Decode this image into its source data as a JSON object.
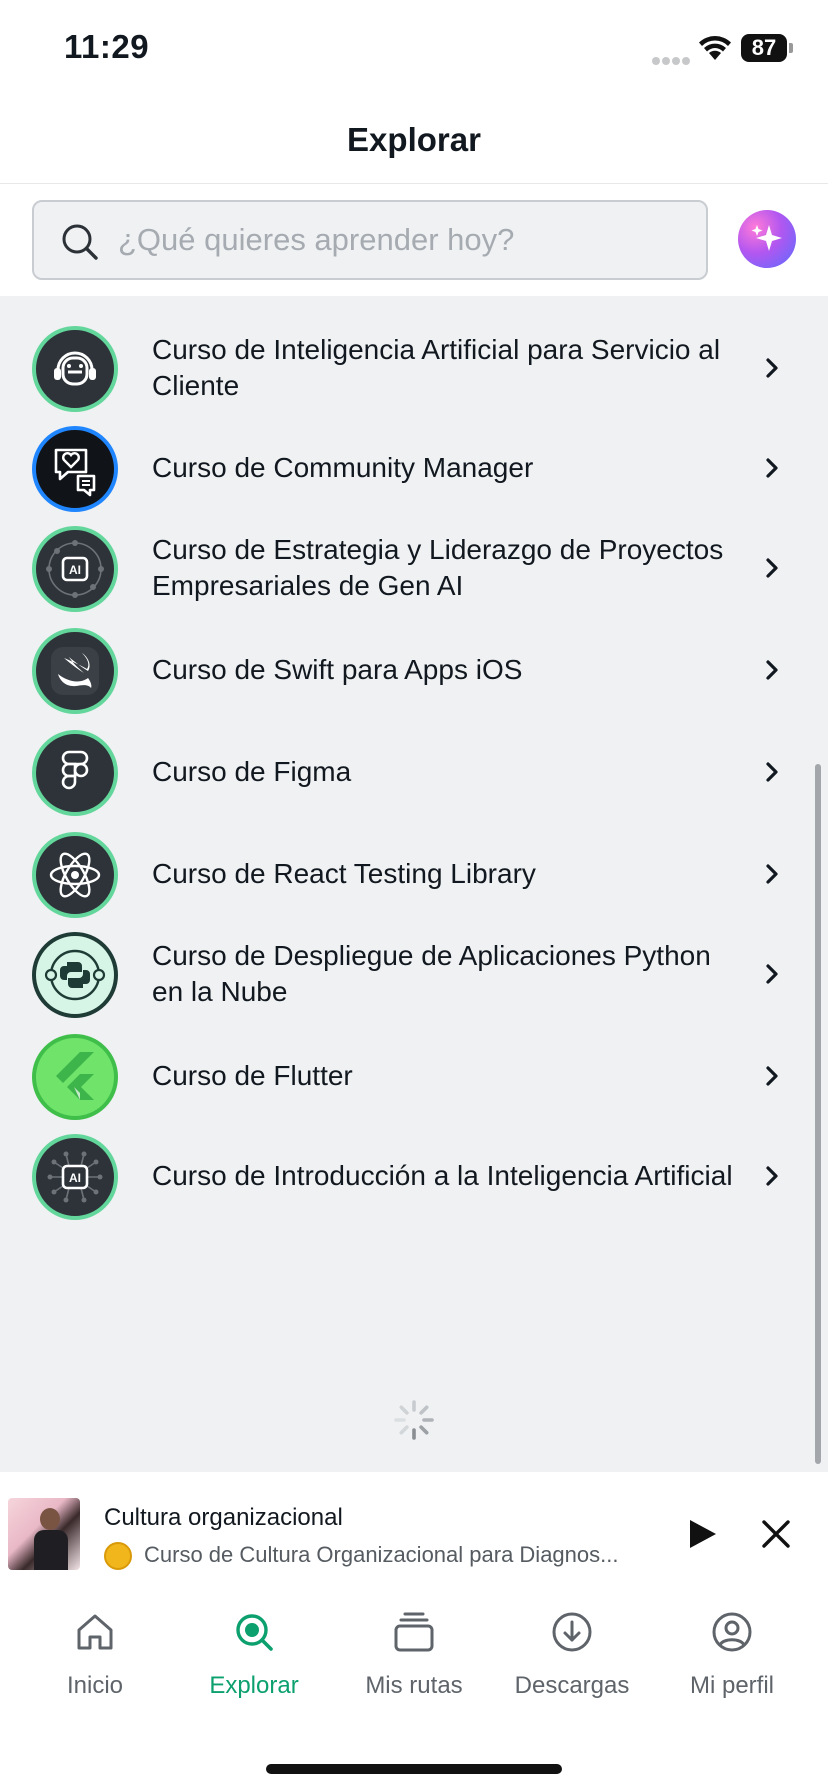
{
  "status_bar": {
    "time": "11:29",
    "battery": "87"
  },
  "header": {
    "title": "Explorar"
  },
  "search": {
    "placeholder": "¿Qué quieres aprender hoy?"
  },
  "courses": [
    {
      "title": "Curso de Inteligencia Artificial para Servicio al Cliente",
      "icon": "headset-robot-icon",
      "ring": "#63d69b"
    },
    {
      "title": "Curso de Community Manager",
      "icon": "chat-heart-icon",
      "ring": "#1f86ff"
    },
    {
      "title": "Curso de Estrategia y Liderazgo de Proyectos Empresariales de Gen AI",
      "icon": "ai-network-icon",
      "ring": "#63d69b"
    },
    {
      "title": "Curso de Swift para Apps iOS",
      "icon": "swift-icon",
      "ring": "#63d69b"
    },
    {
      "title": "Curso de Figma",
      "icon": "figma-icon",
      "ring": "#63d69b"
    },
    {
      "title": "Curso de React Testing Library",
      "icon": "react-icon",
      "ring": "#63d69b"
    },
    {
      "title": "Curso de Despliegue de Aplicaciones Python en la Nube",
      "icon": "python-cloud-icon",
      "ring": "#1f3b35"
    },
    {
      "title": "Curso de Flutter",
      "icon": "flutter-icon",
      "ring": "#3fbf4a"
    },
    {
      "title": "Curso de Introducción a la Inteligencia Artificial",
      "icon": "ai-chip-icon",
      "ring": "#63d69b"
    }
  ],
  "mini_player": {
    "title": "Cultura organizacional",
    "subtitle": "Curso de Cultura Organizacional para Diagnos..."
  },
  "tabs": [
    {
      "label": "Inicio",
      "icon": "home-icon",
      "active": false
    },
    {
      "label": "Explorar",
      "icon": "explore-icon",
      "active": true
    },
    {
      "label": "Mis rutas",
      "icon": "stack-icon",
      "active": false
    },
    {
      "label": "Descargas",
      "icon": "download-icon",
      "active": false
    },
    {
      "label": "Mi perfil",
      "icon": "profile-icon",
      "active": false
    }
  ],
  "colors": {
    "accent": "#0ca06f",
    "background": "#eff1f3"
  }
}
